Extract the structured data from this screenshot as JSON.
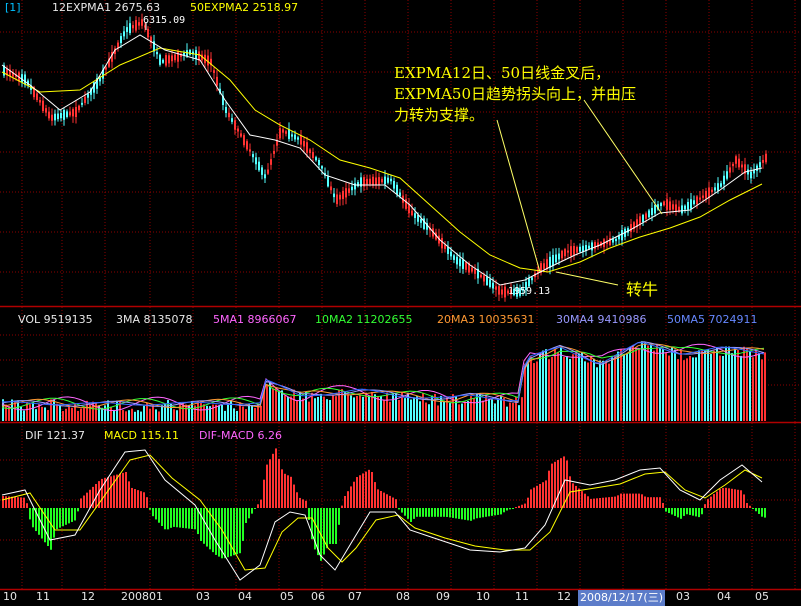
{
  "header": {
    "tag": "[1]",
    "ema1": "12EXPMA1 2675.63",
    "ema2": "50EXPMA2 2518.97"
  },
  "vol_header": {
    "vol": "VOL 9519135",
    "ma3": "3MA 8135078",
    "ma1": "5MA1 8966067",
    "ma2": "10MA2 11202655",
    "ma3b": "20MA3 10035631",
    "ma4": "30MA4 9410986",
    "ma5": "50MA5 7024911"
  },
  "macd_header": {
    "dif": "DIF 121.37",
    "macd": "MACD 115.11",
    "difmacd": "DIF-MACD 6.26"
  },
  "annotation": {
    "line1": "EXPMA12日、50日线金叉后，",
    "line2": "EXPMA50日趋势拐头向上，并由压",
    "line3": "力转为支撑。"
  },
  "turn_label": "转牛",
  "peak_label": "6315.09",
  "trough_label": "1959.13",
  "x_labels": [
    "10",
    "11",
    "12",
    "200801",
    "03",
    "04",
    "05",
    "06",
    "07",
    "08",
    "09",
    "10",
    "11",
    "12",
    "03",
    "04",
    "05"
  ],
  "selected_date": "2008/12/17(三)",
  "colors": {
    "up": "#ff3232",
    "down": "#54ffff",
    "ema12": "#ffffff",
    "ema50": "#ffff00",
    "grid": "#8b0000",
    "ma1": "#ff66ff",
    "ma2": "#33ff33",
    "ma3": "#ff9933",
    "ma4": "#9999ff",
    "ma5": "#3366ff"
  },
  "chart_data": {
    "type": "line",
    "interval": "weekly",
    "series": [
      {
        "name": "12EXPMA1",
        "last": 2675.63
      },
      {
        "name": "50EXPMA2",
        "last": 2518.97
      }
    ],
    "extremes": {
      "high": 6315.09,
      "low": 1959.13
    },
    "volume": {
      "last": 9519135,
      "ma": [
        8135078,
        8966067,
        11202655,
        10035631,
        9410986,
        7024911
      ]
    },
    "macd": {
      "dif": 121.37,
      "macd": 115.11,
      "hist": 6.26
    }
  }
}
